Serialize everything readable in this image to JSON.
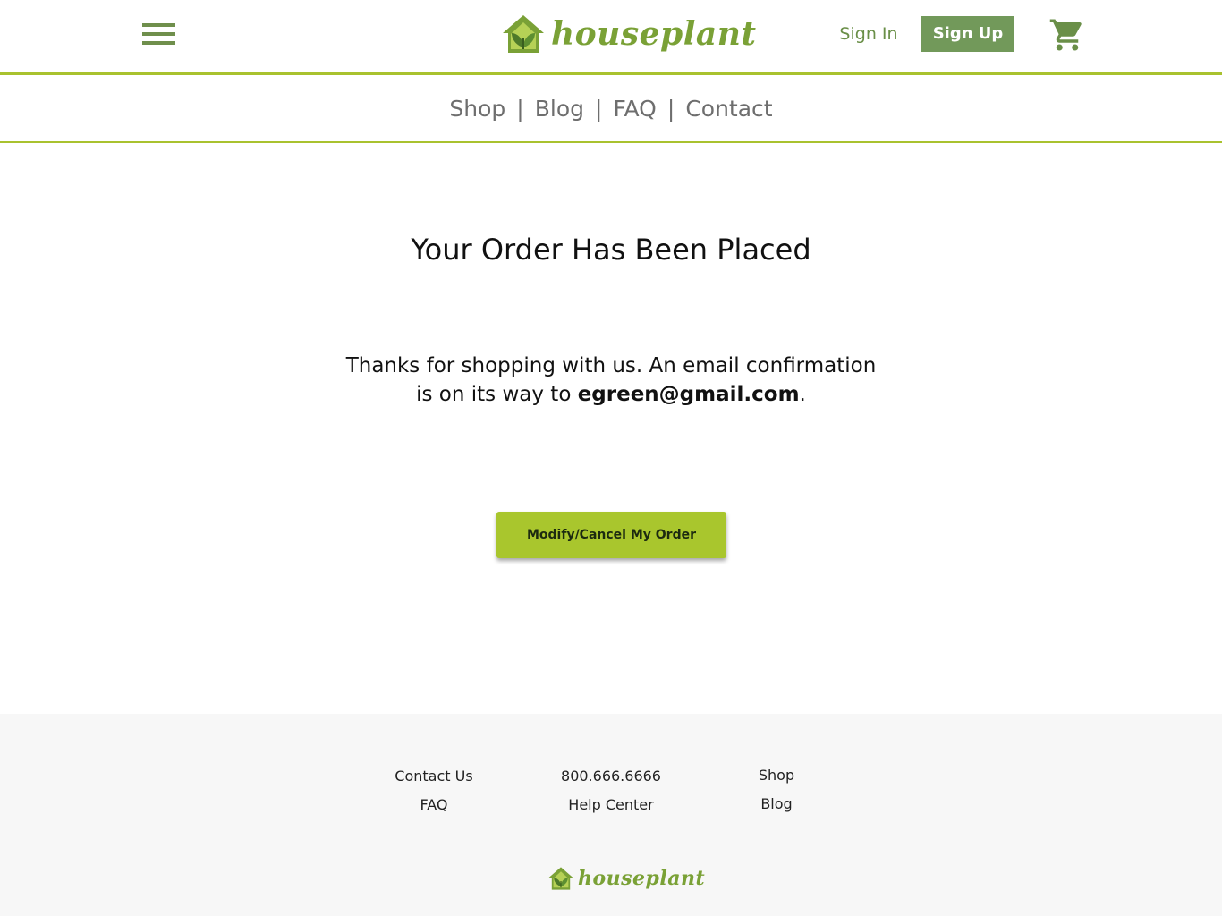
{
  "brand": {
    "name": "houseplant",
    "accent": "#a9c22f",
    "green": "#72995a"
  },
  "header": {
    "sign_in_label": "Sign In",
    "sign_up_label": "Sign Up",
    "menu_icon": "hamburger-menu-icon",
    "cart_icon": "shopping-cart-icon"
  },
  "nav": {
    "items": [
      {
        "label": "Shop"
      },
      {
        "label": "Blog"
      },
      {
        "label": "FAQ"
      },
      {
        "label": "Contact"
      }
    ],
    "separator": "|"
  },
  "main": {
    "title": "Your Order Has Been Placed",
    "message_line1": "Thanks for shopping with us. An email confirmation",
    "message_line2_prefix": "is on its way to ",
    "email": "egreen@gmail.com",
    "message_line2_suffix": ".",
    "cta_label": "Modify/Cancel My Order"
  },
  "footer": {
    "col1": [
      "Contact Us",
      "FAQ"
    ],
    "col2": [
      "800.666.6666",
      "Help Center"
    ],
    "col3": [
      "Shop",
      "Blog"
    ],
    "logo_text": "houseplant"
  }
}
